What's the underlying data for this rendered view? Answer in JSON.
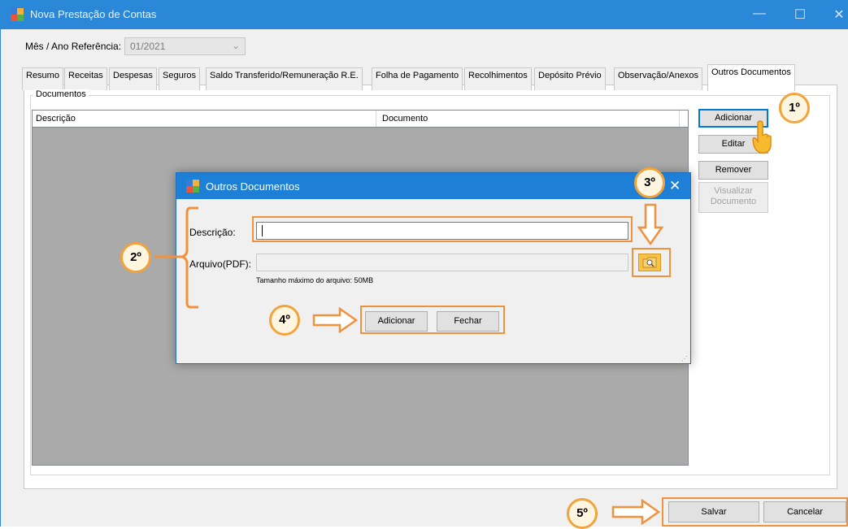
{
  "window": {
    "title": "Nova Prestação de Contas"
  },
  "reference": {
    "label": "Mês / Ano Referência:",
    "value": "01/2021"
  },
  "tabs": [
    "Resumo",
    "Receitas",
    "Despesas",
    "Seguros",
    "Saldo Transferido/Remuneração R.E.",
    "Folha de Pagamento",
    "Recolhimentos",
    "Depósito Prévio",
    "Observação/Anexos",
    "Outros Documentos"
  ],
  "active_tab": "Outros Documentos",
  "documents": {
    "group_label": "Documentos",
    "columns": [
      "Descrição",
      "Documento"
    ],
    "rows": []
  },
  "side_buttons": {
    "add": "Adicionar",
    "edit": "Editar",
    "remove": "Remover",
    "view": "Visualizar Documento"
  },
  "dialog": {
    "title": "Outros Documentos",
    "description_label": "Descrição:",
    "description_value": "",
    "file_label": "Arquivo(PDF):",
    "file_value": "",
    "max_size_note": "Tamanho máximo do arquivo: 50MB",
    "add_button": "Adicionar",
    "close_button": "Fechar"
  },
  "footer": {
    "save": "Salvar",
    "cancel": "Cancelar"
  },
  "annotations": {
    "step1": "1º",
    "step2": "2º",
    "step3": "3º",
    "step4": "4º",
    "step5": "5º"
  },
  "colors": {
    "accent": "#2b88d8",
    "annotation": "#f2913d",
    "badge_fill": "#fff6e2"
  }
}
